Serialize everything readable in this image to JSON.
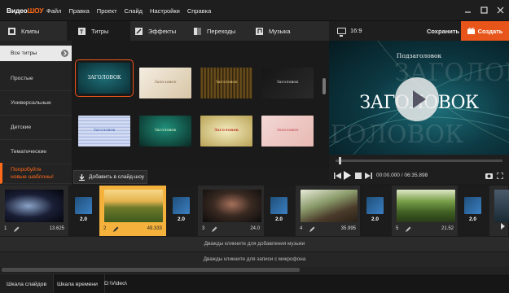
{
  "app": {
    "logo_a": "Видео",
    "logo_b": "ШОУ"
  },
  "menu": [
    "Файл",
    "Правка",
    "Проект",
    "Слайд",
    "Настройки",
    "Справка"
  ],
  "tabs": [
    {
      "label": "Клипы",
      "icon": "clips-icon"
    },
    {
      "label": "Титры",
      "icon": "titles-icon"
    },
    {
      "label": "Эффекты",
      "icon": "effects-icon"
    },
    {
      "label": "Переходы",
      "icon": "transitions-icon"
    },
    {
      "label": "Музыка",
      "icon": "music-icon"
    }
  ],
  "preview_header": {
    "ratio": "16:9",
    "save": "Сохранить",
    "create": "Создать"
  },
  "sidebar": {
    "items": [
      "Все титры",
      "Простые",
      "Универсальные",
      "Детские",
      "Тематические"
    ],
    "promo_line1": "Попробуйте",
    "promo_line2": "новые шаблоны!"
  },
  "gallery": {
    "titles": [
      "ЗАГОЛОВОК",
      "Заголовок",
      "Заголовок",
      "Заголовок",
      "Заголовок",
      "Заголовок",
      "Заголовок",
      "Заголовок"
    ],
    "add_button": "Добавить в слайд-шоу"
  },
  "preview": {
    "subtitle": "Подзаголовок",
    "title": "ЗАГОЛОВОК",
    "ghost_1": "ЗАГОЛОВОК",
    "ghost_2": "ЗАГОЛОВОК"
  },
  "player": {
    "time": "00:00.000 / 06:35.898",
    "progress_fraction": 0.02
  },
  "timeline": {
    "slides": [
      {
        "num": "1",
        "dur": "13.625"
      },
      {
        "num": "2",
        "dur": "49.333"
      },
      {
        "num": "3",
        "dur": "24.0"
      },
      {
        "num": "4",
        "dur": "35.995"
      },
      {
        "num": "5",
        "dur": "21.52"
      }
    ],
    "transitions": [
      "2.0",
      "2.0",
      "2.0",
      "2.0",
      "2.0"
    ],
    "music_hint": "Дважды кликните для добавления музыки",
    "mic_hint": "Дважды кликните для записи с микрофона"
  },
  "bottom": {
    "tab_slides": "Шкала слайдов",
    "tab_time": "Шкала времени",
    "path": "D:\\Video\\"
  },
  "colors": {
    "accent": "#e8551a",
    "selected_slide": "#f4b23c"
  }
}
